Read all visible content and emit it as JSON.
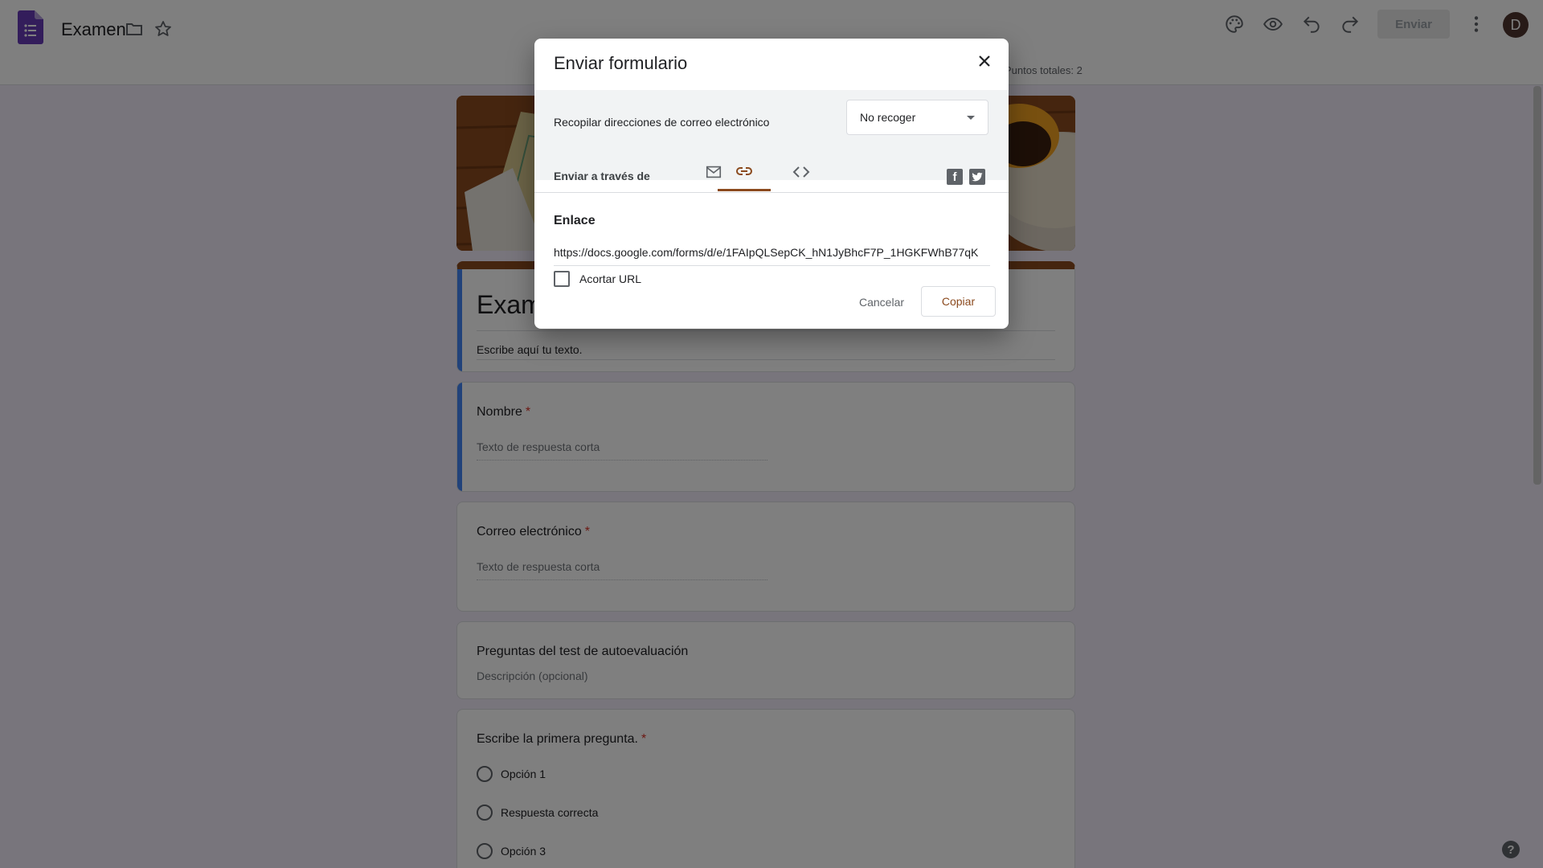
{
  "app": {
    "title": "Examen",
    "send_label": "Enviar",
    "avatar_initial": "D",
    "total_points": "Puntos totales: 2",
    "theme_color": "#8b4a1e",
    "logo_color": "#673ab7"
  },
  "form": {
    "title": "Examen",
    "description": "Escribe aquí tu texto.",
    "questions": [
      {
        "label": "Nombre",
        "required": "*",
        "placeholder": "Texto de respuesta corta"
      },
      {
        "label": "Correo electrónico",
        "required": "*",
        "placeholder": "Texto de respuesta corta"
      }
    ],
    "section": {
      "title": "Preguntas del test de autoevaluación",
      "description": "Descripción (opcional)"
    },
    "mc_question": {
      "label": "Escribe la primera pregunta.",
      "required": "*",
      "options": [
        "Opción 1",
        "Respuesta correcta",
        "Opción 3"
      ]
    }
  },
  "dialog": {
    "title": "Enviar formulario",
    "collect_label": "Recopilar direcciones de correo electrónico",
    "collect_value": "No recoger",
    "send_via_label": "Enviar a través de",
    "tabs": [
      "mail-icon",
      "link-icon",
      "embed-icon"
    ],
    "active_tab": "link-icon",
    "social": [
      "facebook-icon",
      "twitter-icon"
    ],
    "link_title": "Enlace",
    "link_url": "https://docs.google.com/forms/d/e/1FAIpQLSepCK_hN1JyBhcF7P_1HGKFWhB77qK",
    "shorten_label": "Acortar URL",
    "cancel_label": "Cancelar",
    "copy_label": "Copiar"
  }
}
